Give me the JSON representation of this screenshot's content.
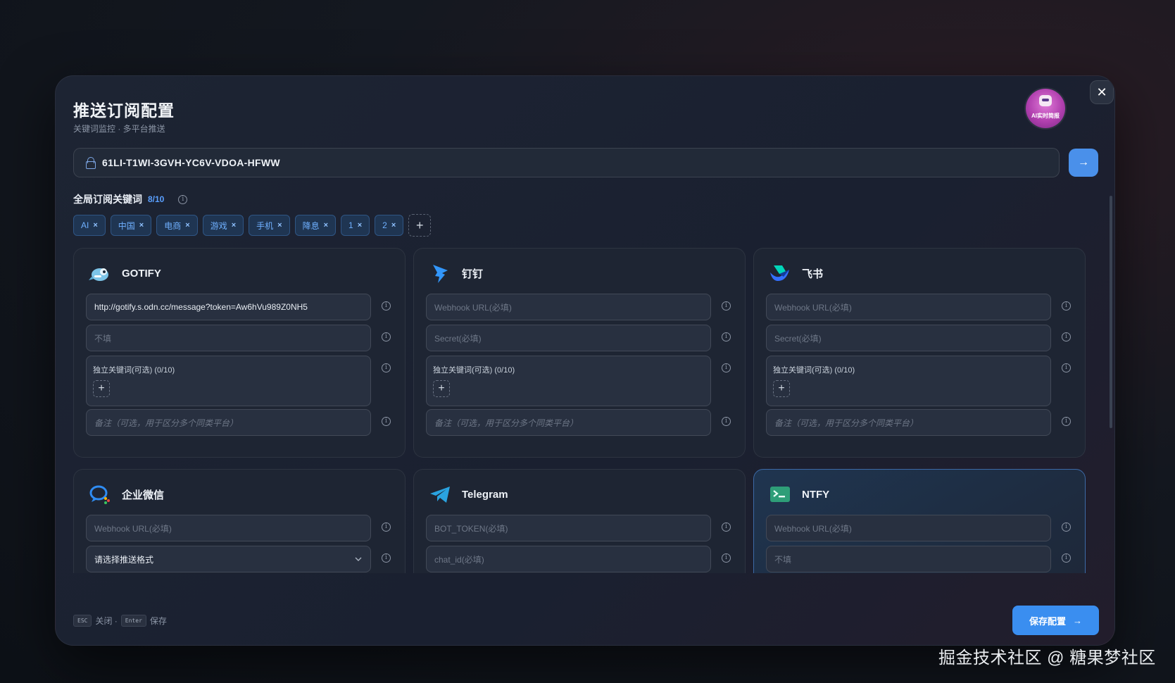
{
  "header": {
    "title": "推送订阅配置",
    "subtitle": "关键词监控 · 多平台推送",
    "avatar_label": "AI实时简报",
    "close_glyph": "✕"
  },
  "token": {
    "value": "61LI-T1WI-3GVH-YC6V-VDOA-HFWW",
    "submit_glyph": "→"
  },
  "keywords": {
    "title": "全局订阅关键词",
    "count": "8/10",
    "items": [
      "AI",
      "中国",
      "电商",
      "游戏",
      "手机",
      "降息",
      "1",
      "2"
    ],
    "remove_glyph": "×",
    "add_glyph": "+"
  },
  "cards": [
    {
      "name": "GOTIFY",
      "icon": "gotify-icon",
      "url_value": "http://gotify.s.odn.cc/message?token=Aw6hVu989Z0NH5",
      "second_placeholder": "不填",
      "kw_label": "独立关键词(可选) (0/10)",
      "note_placeholder": "备注（可选，用于区分多个同类平台）"
    },
    {
      "name": "钉钉",
      "icon": "dingtalk-icon",
      "url_placeholder": "Webhook URL(必填)",
      "second_placeholder": "Secret(必填)",
      "kw_label": "独立关键词(可选) (0/10)",
      "note_placeholder": "备注（可选，用于区分多个同类平台）"
    },
    {
      "name": "飞书",
      "icon": "feishu-icon",
      "url_placeholder": "Webhook URL(必填)",
      "second_placeholder": "Secret(必填)",
      "kw_label": "独立关键词(可选) (0/10)",
      "note_placeholder": "备注（可选，用于区分多个同类平台）"
    },
    {
      "name": "企业微信",
      "icon": "wecom-icon",
      "url_placeholder": "Webhook URL(必填)",
      "select_value": "请选择推送格式"
    },
    {
      "name": "Telegram",
      "icon": "telegram-icon",
      "url_placeholder": "BOT_TOKEN(必填)",
      "second_placeholder": "chat_id(必填)"
    },
    {
      "name": "NTFY",
      "icon": "ntfy-icon",
      "url_placeholder": "Webhook URL(必填)",
      "second_placeholder": "不填"
    }
  ],
  "footer": {
    "esc_key": "ESC",
    "esc_label": "关闭 ·",
    "enter_key": "Enter",
    "enter_label": "保存",
    "save_label": "保存配置",
    "save_glyph": "→"
  },
  "watermark": "掘金技术社区 @ 糖果梦社区",
  "colors": {
    "accent": "#3a8ef0",
    "chip_bg": "#1f3552",
    "chip_text": "#6fb0ff",
    "card_bg": "#1e2533"
  }
}
